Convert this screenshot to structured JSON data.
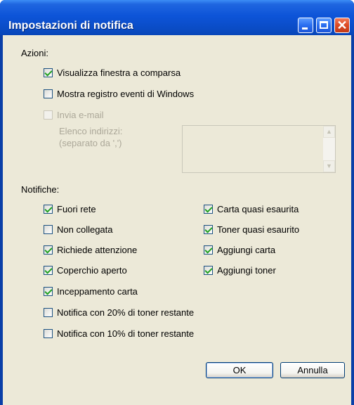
{
  "window": {
    "title": "Impostazioni di notifica",
    "controls": {
      "minimize_icon": "minimize-icon",
      "maximize_icon": "maximize-icon",
      "close_icon": "close-icon"
    }
  },
  "actions": {
    "label": "Azioni:",
    "popup": {
      "label": "Visualizza finestra a comparsa",
      "checked": true
    },
    "eventlog": {
      "label": "Mostra registro eventi di Windows",
      "checked": false
    },
    "email": {
      "label": "Invia e-mail",
      "checked": false,
      "enabled": false
    },
    "address_label_line1": "Elenco indirizzi:",
    "address_label_line2": "(separato da ',')",
    "address_value": ""
  },
  "notifications": {
    "label": "Notifiche:",
    "offline": {
      "label": "Fuori rete",
      "checked": true
    },
    "not_connected": {
      "label": "Non collegata",
      "checked": false
    },
    "attention": {
      "label": "Richiede attenzione",
      "checked": true
    },
    "cover_open": {
      "label": "Coperchio aperto",
      "checked": true
    },
    "paper_jam": {
      "label": "Inceppamento carta",
      "checked": true
    },
    "toner20": {
      "label": "Notifica con 20% di toner restante",
      "checked": false
    },
    "toner10": {
      "label": "Notifica con 10% di toner restante",
      "checked": false
    },
    "paper_low": {
      "label": "Carta quasi esaurita",
      "checked": true
    },
    "toner_low": {
      "label": "Toner quasi esaurito",
      "checked": true
    },
    "add_paper": {
      "label": "Aggiungi carta",
      "checked": true
    },
    "add_toner": {
      "label": "Aggiungi toner",
      "checked": true
    }
  },
  "buttons": {
    "ok": "OK",
    "cancel": "Annulla"
  },
  "colors": {
    "titlebar": "#0a4cc6",
    "client": "#ece9d8",
    "check": "#21a121",
    "close": "#dd4a25"
  }
}
